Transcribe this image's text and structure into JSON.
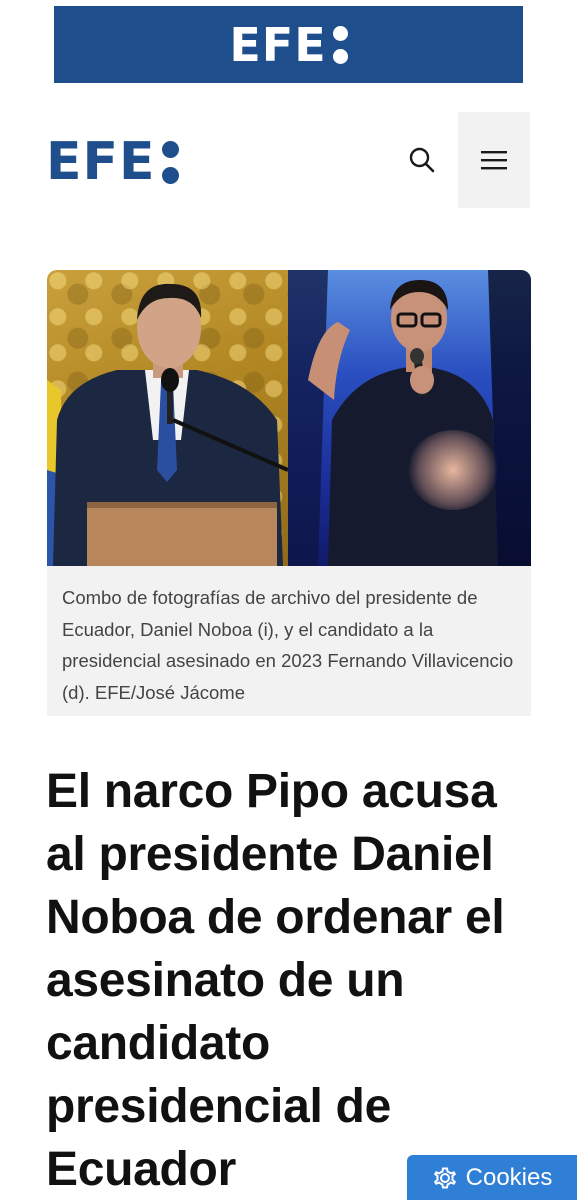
{
  "ad_banner": {
    "logo_text": "EFE"
  },
  "header": {
    "logo_text": "EFE",
    "search_icon": "search-icon",
    "menu_icon": "hamburger-menu-icon"
  },
  "article": {
    "image_caption": "Combo de fotografías de archivo del presidente de Ecuador, Daniel Noboa (i), y el candidato a la presidencial asesinado en 2023 Fernando Villavicencio (d). EFE/José Jácome",
    "headline": "El narco Pipo acusa al presidente Daniel Noboa de ordenar el asesinato de un candidato presidencial de Ecuador"
  },
  "cookies": {
    "label": "Cookies",
    "icon": "gear-icon"
  },
  "colors": {
    "brand_blue": "#1f4e8c",
    "cookies_blue": "#2f7fd6",
    "caption_bg": "#f2f2f2"
  }
}
